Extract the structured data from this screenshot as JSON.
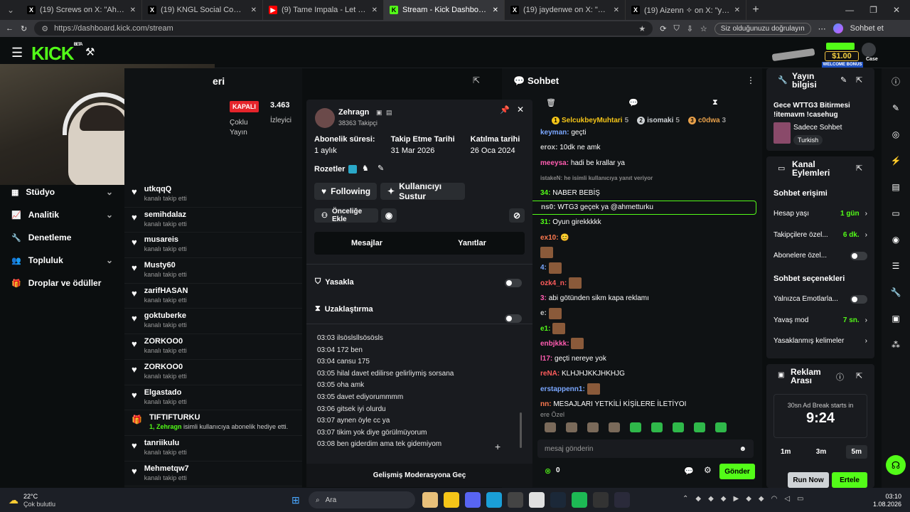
{
  "browser": {
    "tabs": [
      {
        "title": "(19) Screws on X: \"AhmetTurku Bu",
        "icon": "x-icon"
      },
      {
        "title": "(19) KNGL Social Community / X",
        "icon": "x-icon"
      },
      {
        "title": "(9) Tame Impala - Let It Happen (O",
        "icon": "youtube-icon"
      },
      {
        "title": "Stream - Kick Dashboard",
        "icon": "kick-icon",
        "active": true
      },
      {
        "title": "(19) jaydenwe on X: \"Evleri yakın ol",
        "icon": "x-icon"
      },
      {
        "title": "(19) Aizenn ✧ on X: \"yemek yaş",
        "icon": "x-icon"
      }
    ],
    "url": "https://dashboard.kick.com/stream",
    "profile_badge": "Siz olduğunuzu doğrulayın",
    "profile_label": "Sohbet et"
  },
  "topnav": {
    "logo": "KICK",
    "logo_beta": "BETA",
    "promo_amount": "$1.00",
    "promo_label": "WELCOME BONUS",
    "promo_brand": "Case"
  },
  "sidebar": {
    "items": [
      {
        "label": "Stüdyo",
        "icon": "studio-icon",
        "chevron": true
      },
      {
        "label": "Analitik",
        "icon": "analytics-icon",
        "chevron": true
      },
      {
        "label": "Denetleme",
        "icon": "moderation-icon",
        "chevron": false
      },
      {
        "label": "Topluluk",
        "icon": "community-icon",
        "chevron": true
      },
      {
        "label": "Droplar ve ödüller",
        "icon": "drops-icon",
        "chevron": false
      }
    ]
  },
  "stream_panel": {
    "title_partial": "eri",
    "status": "KAPALI",
    "status_label": "Çoklu Yayın",
    "viewers": "3.463",
    "viewers_label": "İzleyici"
  },
  "followers": [
    {
      "name": "utkqqQ",
      "sub": "kanalı takip etti",
      "type": "follow"
    },
    {
      "name": "semihdalaz",
      "sub": "kanalı takip etti",
      "type": "follow"
    },
    {
      "name": "musareis",
      "sub": "kanalı takip etti",
      "type": "follow"
    },
    {
      "name": "Musty60",
      "sub": "kanalı takip etti",
      "type": "follow"
    },
    {
      "name": "zarifHASAN",
      "sub": "kanalı takip etti",
      "type": "follow"
    },
    {
      "name": "goktuberke",
      "sub": "kanalı takip etti",
      "type": "follow"
    },
    {
      "name": "ZORKOO0",
      "sub": "kanalı takip etti",
      "type": "follow"
    },
    {
      "name": "ZORKOO0",
      "sub": "kanalı takip etti",
      "type": "follow"
    },
    {
      "name": "Elgastado",
      "sub": "kanalı takip etti",
      "type": "follow"
    },
    {
      "name": "TIFTIFTURKU",
      "sub_num": "1,",
      "sub_user": "Zehragn",
      "sub_rest": " isimli kullanıcıya abonelik hediye etti.",
      "type": "gift"
    },
    {
      "name": "tanriikulu",
      "sub": "kanalı takip etti",
      "type": "follow"
    },
    {
      "name": "Mehmetqw7",
      "sub": "kanalı takip etti",
      "type": "follow"
    }
  ],
  "usercard": {
    "username": "Zehragn",
    "followers": "38363 Takipçi",
    "stats": [
      {
        "label": "Abonelik süresi:",
        "value": "1 aylık"
      },
      {
        "label": "Takip Etme Tarihi",
        "value": "31 Mar 2026"
      },
      {
        "label": "Katılma tarihi",
        "value": "26 Oca 2024"
      }
    ],
    "badges_label": "Rozetler",
    "following_btn": "Following",
    "mute_btn": "Kullanıcıyı Sustur",
    "priority_btn": "Önceliğe Ekle",
    "tab_messages": "Mesajlar",
    "tab_replies": "Yanıtlar",
    "ban_label": "Yasakla",
    "timeout_label": "Uzaklaştırma",
    "messages": [
      {
        "time": "03:03",
        "text": "ilsöslsllsösösls"
      },
      {
        "time": "03:04",
        "text": "172 ben"
      },
      {
        "time": "03:04",
        "text": "cansu 175"
      },
      {
        "time": "03:05",
        "text": "hilal davet edilirse gelirliymiş sorsana"
      },
      {
        "time": "03:05",
        "text": "oha amk"
      },
      {
        "time": "03:05",
        "text": "davet ediyorummmm"
      },
      {
        "time": "03:06",
        "text": "gitsek iyi olurdu"
      },
      {
        "time": "03:07",
        "text": "aynen öyle cc ya"
      },
      {
        "time": "03:07",
        "text": "tikim yok diye görülmüyorum"
      },
      {
        "time": "03:08",
        "text": "ben giderdim ama tek gidemiyom"
      }
    ],
    "advanced_mod": "Gelişmiş Moderasyona Geç"
  },
  "chat": {
    "title": "Sohbet",
    "top_gifters": [
      {
        "name": "SelcukbeyMuhtari",
        "count": "5",
        "rank": "1",
        "color": "#f5c518"
      },
      {
        "name": "isomaki",
        "count": "5",
        "rank": "2",
        "color": "#cfd3d6"
      },
      {
        "name": "c0dwa",
        "count": "3",
        "rank": "3",
        "color": "#e8a04a"
      }
    ],
    "lines": [
      {
        "user": "keyman:",
        "color": "#7aa7ff",
        "text": "geçti"
      },
      {
        "user": "erox:",
        "color": "#c9c9c9",
        "text": "10dk ne amk"
      },
      {
        "user": "meeysa:",
        "color": "#ff5cb0",
        "text": "hadi be krallar ya"
      },
      {
        "user": "istakeN: he isimli kullanıcıya yanıt veriyor",
        "color": "#888",
        "text": "",
        "reply": true
      },
      {
        "user": "34:",
        "color": "#53fc18",
        "text": "NABER BEBİŞ"
      },
      {
        "user": "ns0:",
        "color": "#c9c9c9",
        "text": "WTG3 geçek ya @ahmetturku",
        "highlight": true
      },
      {
        "user": "31:",
        "color": "#53fc18",
        "text": "Oyun girekkkkk"
      },
      {
        "user": "ex10:",
        "color": "#ff7a50",
        "text": "😊"
      },
      {
        "user": "",
        "color": "#c9c9c9",
        "text": "[emote]"
      },
      {
        "user": "4:",
        "color": "#7aa7ff",
        "text": "[emote]"
      },
      {
        "user": "ozk4_n:",
        "color": "#ff5c5c",
        "text": "[emote]"
      },
      {
        "user": "3:",
        "color": "#ff5cb0",
        "text": "abi götünden sikm kapa reklamı"
      },
      {
        "user": "e:",
        "color": "#c9c9c9",
        "text": "[emote]"
      },
      {
        "user": "e1:",
        "color": "#53fc18",
        "text": "[emote]"
      },
      {
        "user": "enbjkkk:",
        "color": "#ff5cb0",
        "text": "[emote]"
      },
      {
        "user": "l17:",
        "color": "#ff5cb0",
        "text": "geçti nereye yok"
      },
      {
        "user": "reNA:",
        "color": "#ff5c5c",
        "text": "KLHJHJKKJHKHJG"
      },
      {
        "user": "erstappenn1:",
        "color": "#7aa7ff",
        "text": "[emote]"
      },
      {
        "user": "nn:",
        "color": "#ff7a50",
        "text": "MESAJLARI YETKİLİ KİŞİLERE İLETİYOI"
      }
    ],
    "emote_section": "ere Özel",
    "input_placeholder": "mesaj gönderin",
    "points": "0",
    "send_btn": "Gönder"
  },
  "stream_info": {
    "title": "Yayın bilgisi",
    "stream_title": "Gece WTTG3 Bitirmesi !itemavm !casehug",
    "category": "Sadece Sohbet",
    "language": "Turkish"
  },
  "channel_actions": {
    "title": "Kanal Eylemleri",
    "chat_access": "Sohbet erişimi",
    "rows": [
      {
        "label": "Hesap yaşı",
        "value": "1 gün",
        "kind": "link"
      },
      {
        "label": "Takipçilere özel...",
        "value": "6 dk.",
        "kind": "link"
      },
      {
        "label": "Abonelere özel...",
        "value": "",
        "kind": "toggle"
      }
    ],
    "chat_options": "Sohbet seçenekleri",
    "options": [
      {
        "label": "Yalnızca Emotlarla...",
        "value": "",
        "kind": "toggle"
      },
      {
        "label": "Yavaş mod",
        "value": "7 sn.",
        "kind": "link"
      },
      {
        "label": "Yasaklanmış kelimeler",
        "value": "",
        "kind": "link"
      }
    ]
  },
  "ad_break": {
    "title": "Reklam Arası",
    "starts_in": "30sn Ad Break starts in",
    "countdown": "9:24",
    "durations": [
      "1m",
      "3m",
      "5m"
    ],
    "selected": "5m",
    "run_now": "Run Now",
    "postpone": "Ertele"
  },
  "taskbar": {
    "weather_temp": "22°C",
    "weather_desc": "Çok bulutlu",
    "search": "Ara",
    "time": "03:10",
    "date": "1.08.2026"
  }
}
